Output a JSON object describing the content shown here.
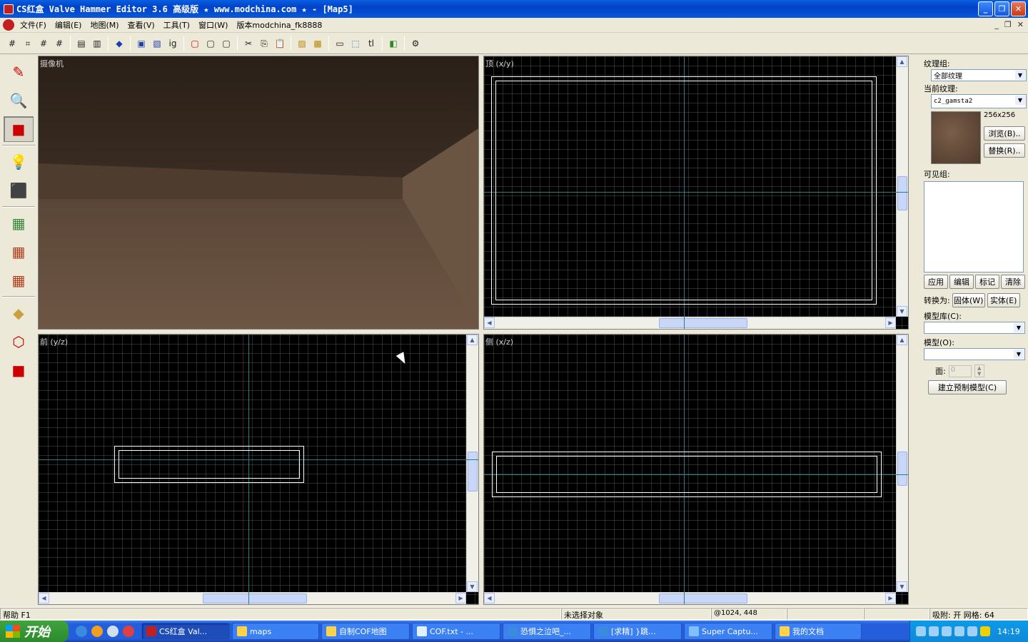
{
  "window": {
    "title": "CS红盒 Valve Hammer Editor 3.6 高级版 ★ www.modchina.com ★ - [Map5]"
  },
  "menubar": {
    "items": [
      "文件(F)",
      "编辑(E)",
      "地图(M)",
      "查看(V)",
      "工具(T)",
      "窗口(W)",
      "版本modchina_fk8888"
    ]
  },
  "toolbar": {
    "icons": [
      "grid-toggle-icon",
      "grid-3d-icon",
      "grid-smaller-icon",
      "grid-larger-icon",
      "group-icon",
      "ungroup-icon",
      "carve-icon",
      "hide-icon",
      "show-icon",
      "ignore-group-icon",
      "tl-icon",
      "texture-lock-icon",
      "cut-icon",
      "copy-icon",
      "paste-icon",
      "texture-app-icon",
      "decal-icon",
      "bounding-icon",
      "select-icon",
      "tl-label",
      "run-map-icon",
      "options-icon"
    ]
  },
  "views": {
    "camera": {
      "label": "摄像机"
    },
    "top": {
      "label": "顶 (x/y)"
    },
    "front": {
      "label": "前 (y/z)"
    },
    "side": {
      "label": "侧 (x/z)"
    }
  },
  "right_panel": {
    "texture_group_label": "纹理组:",
    "texture_group_value": "全部纹理",
    "current_texture_label": "当前纹理:",
    "current_texture_value": "c2_gamsta2",
    "texture_size": "256x256",
    "browse_button": "浏览(B)..",
    "replace_button": "替换(R)..",
    "visgroups_label": "可见组:",
    "apply_button": "应用",
    "edit_button": "编辑",
    "mark_button": "标记",
    "clear_button": "清除",
    "convert_label": "转换为:",
    "solid_button": "固体(W)",
    "entity_button": "实体(E)",
    "prefab_lib_label": "模型库(C):",
    "prefab_label": "模型(O):",
    "faces_label": "面:",
    "faces_value": "0",
    "create_prefab_button": "建立预制模型(C)"
  },
  "statusbar": {
    "help": "帮助 F1",
    "selection": "未选择对象",
    "coords": "@1024, 448",
    "snap": "吸附: 开 网格: 64"
  },
  "taskbar": {
    "start_label": "开始",
    "tasks": [
      "CS红盒 Val...",
      "maps",
      "自制COF地图",
      "COF.txt - ...",
      "恐惧之泣吧_...",
      "[求精] }跳...",
      "Super Captu...",
      "我的文档"
    ],
    "clock": "14:19"
  }
}
